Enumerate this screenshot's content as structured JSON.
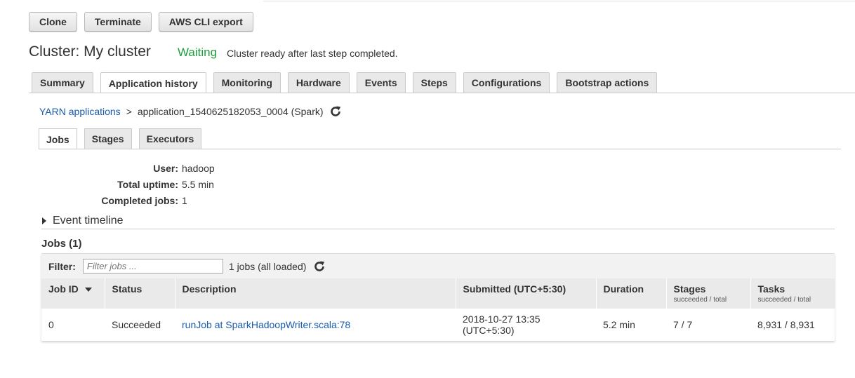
{
  "toolbar": {
    "clone_label": "Clone",
    "terminate_label": "Terminate",
    "cli_export_label": "AWS CLI export"
  },
  "cluster": {
    "title": "Cluster: My cluster",
    "status": "Waiting",
    "status_message": "Cluster ready after last step completed.",
    "status_color": "#1e9e3e"
  },
  "main_tabs": [
    {
      "label": "Summary"
    },
    {
      "label": "Application history",
      "active": true
    },
    {
      "label": "Monitoring"
    },
    {
      "label": "Hardware"
    },
    {
      "label": "Events"
    },
    {
      "label": "Steps"
    },
    {
      "label": "Configurations"
    },
    {
      "label": "Bootstrap actions"
    }
  ],
  "breadcrumb": {
    "parent": "YARN applications",
    "separator": ">",
    "current": "application_1540625182053_0004 (Spark)",
    "refresh_icon": "refresh-icon"
  },
  "sub_tabs": [
    {
      "label": "Jobs",
      "active": true
    },
    {
      "label": "Stages"
    },
    {
      "label": "Executors"
    }
  ],
  "summary": {
    "user_label": "User:",
    "user": "hadoop",
    "uptime_label": "Total uptime:",
    "uptime": "5.5 min",
    "completed_label": "Completed jobs:",
    "completed": "1"
  },
  "event_timeline": {
    "label": "Event timeline"
  },
  "jobs": {
    "heading": "Jobs (1)",
    "filter_label": "Filter:",
    "filter_placeholder": "Filter jobs ...",
    "filter_count": "1 jobs (all loaded)",
    "columns": [
      {
        "label": "Job ID"
      },
      {
        "label": "Status"
      },
      {
        "label": "Description"
      },
      {
        "label": "Submitted (UTC+5:30)"
      },
      {
        "label": "Duration"
      },
      {
        "label": "Stages",
        "sub": "succeeded / total"
      },
      {
        "label": "Tasks",
        "sub": "succeeded / total"
      }
    ],
    "rows": [
      {
        "job_id": "0",
        "status": "Succeeded",
        "description": "runJob at SparkHadoopWriter.scala:78",
        "submitted_date": "2018-10-27 13:35",
        "submitted_tz": "(UTC+5:30)",
        "duration": "5.2 min",
        "stages": "7 / 7",
        "tasks": "8,931 / 8,931"
      }
    ]
  }
}
